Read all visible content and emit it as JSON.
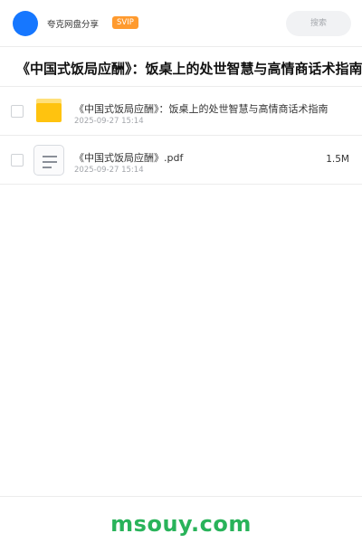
{
  "header": {
    "app_name": "夸克网盘分享",
    "badge": "SVIP",
    "search_placeholder": "搜索"
  },
  "page_title": "《中国式饭局应酬》：饭桌上的处世智慧与高情商话术指南",
  "files": [
    {
      "type": "folder",
      "name": "《中国式饭局应酬》：饭桌上的处世智慧与高情商话术指南",
      "date": "2025-09-27 15:14",
      "size": ""
    },
    {
      "type": "pdf",
      "name": "《中国式饭局应酬》.pdf",
      "date": "2025-09-27 15:14",
      "size": "1.5M"
    }
  ],
  "footer": {
    "watermark": "msouy.com"
  },
  "colors": {
    "accent": "#1677ff",
    "svip": "#ff9a2e",
    "folder": "#ffc30f",
    "watermark": "#29b35a"
  }
}
